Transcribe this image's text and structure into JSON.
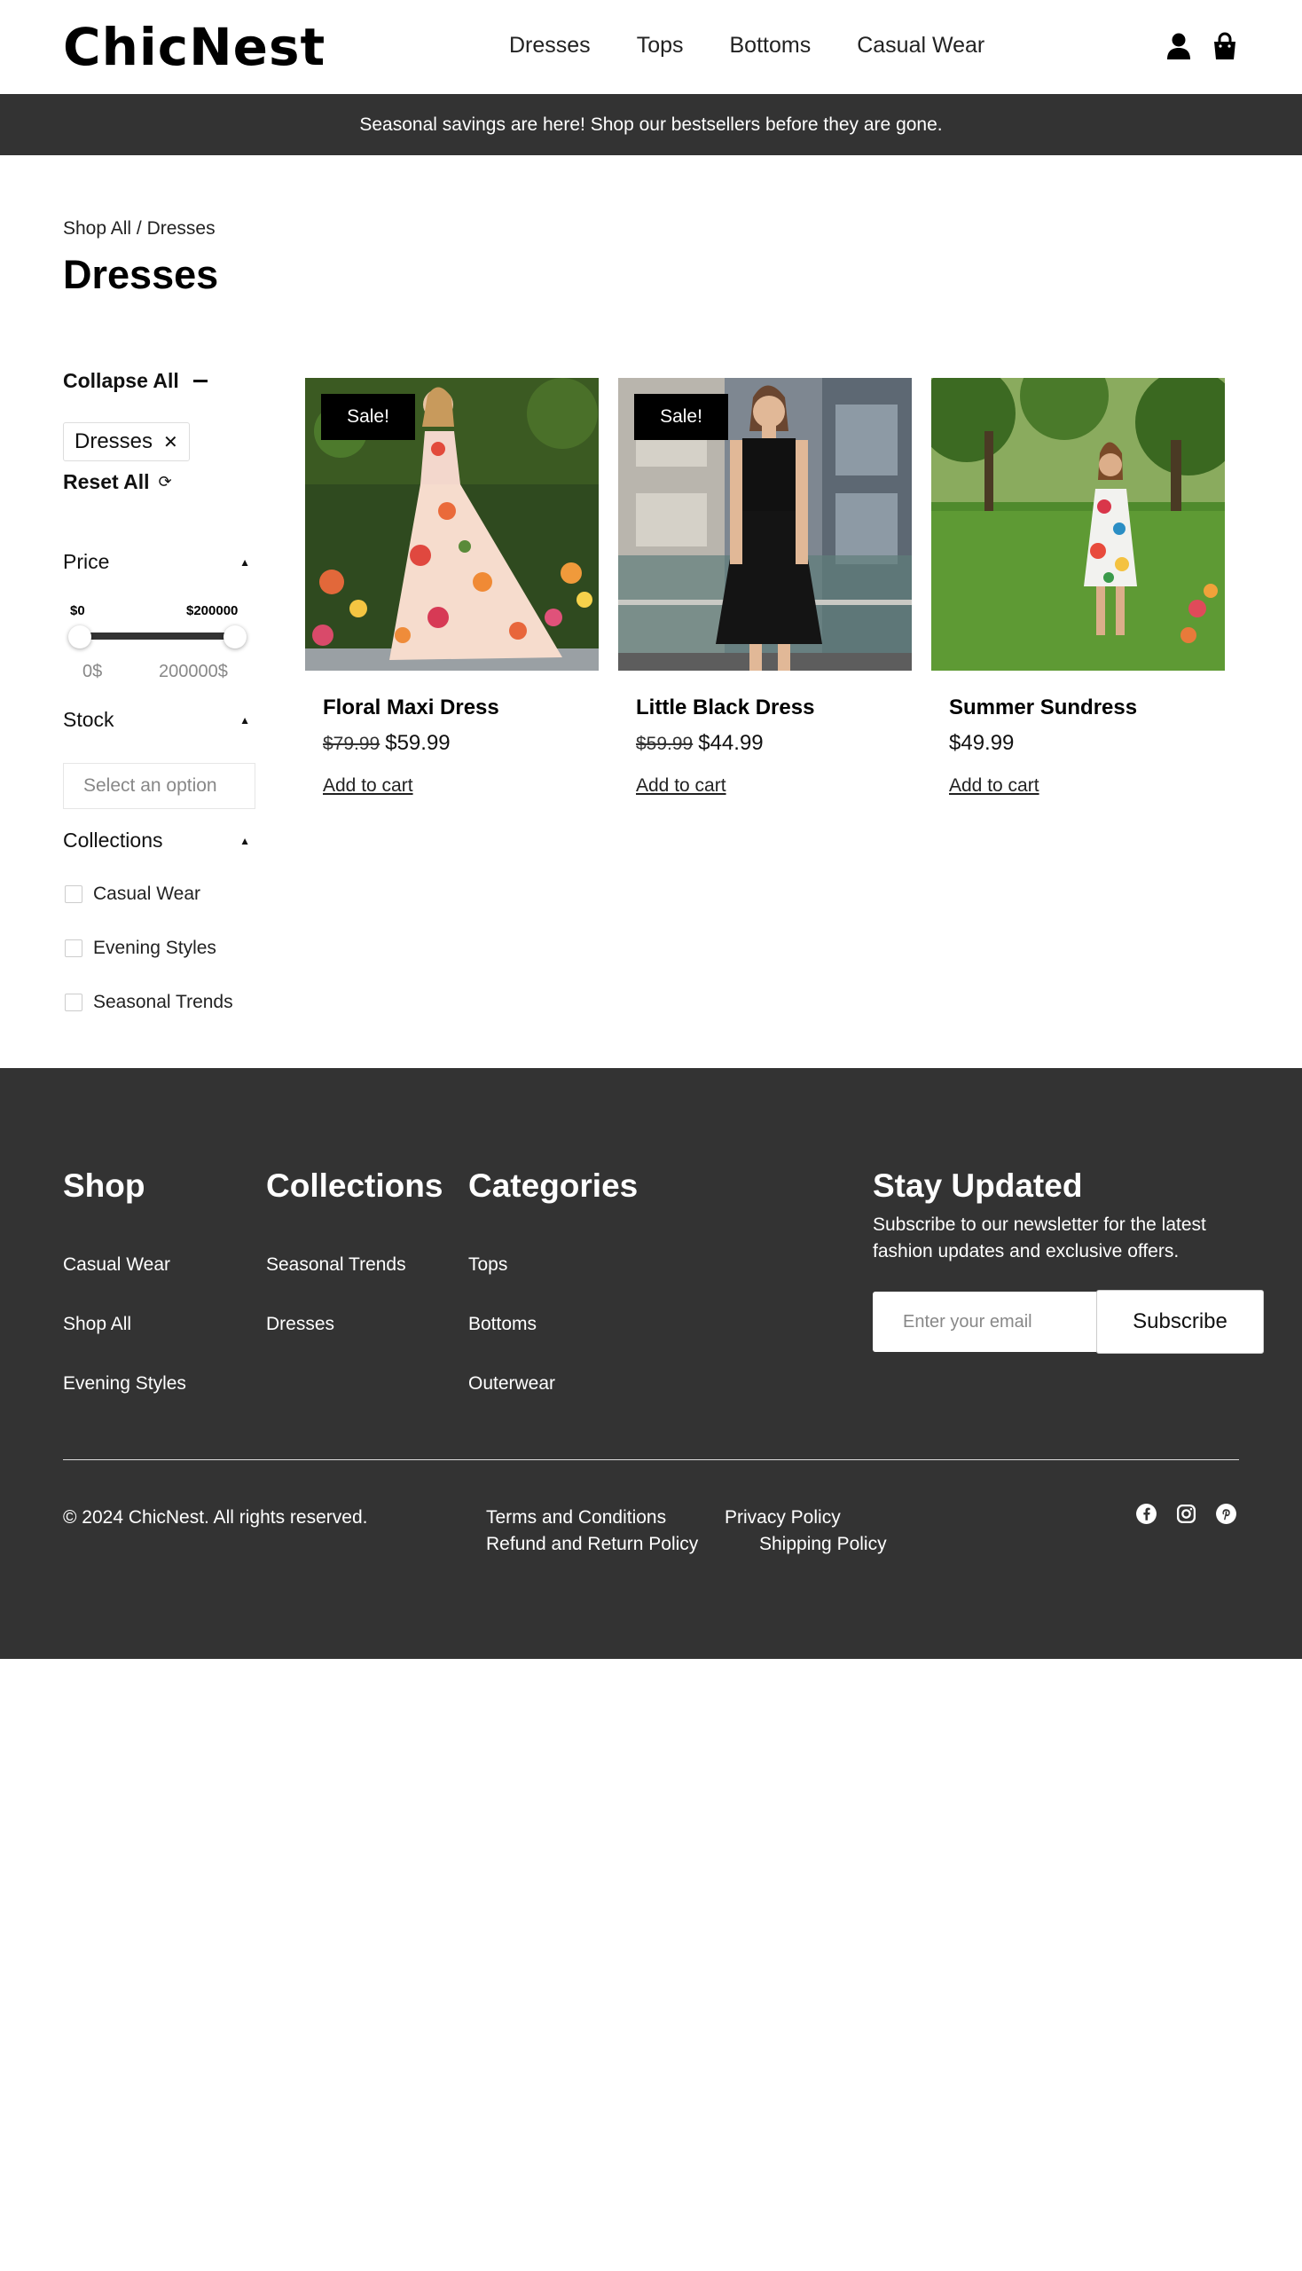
{
  "header": {
    "logo": "ChicNest",
    "nav": [
      "Dresses",
      "Tops",
      "Bottoms",
      "Casual Wear"
    ],
    "icons": [
      "user-icon",
      "shopping-bag-icon"
    ]
  },
  "announcement": "Seasonal savings are here! Shop our bestsellers before they are gone.",
  "breadcrumb": {
    "root": "Shop All",
    "separator": " / ",
    "current": "Dresses"
  },
  "page_title": "Dresses",
  "filters": {
    "collapse_all": "Collapse All",
    "active_chip": "Dresses",
    "chip_close": "✕",
    "reset_all": "Reset All",
    "price": {
      "label": "Price",
      "min_label": "$0",
      "max_label": "$200000",
      "min_input": "0$",
      "max_input": "200000$"
    },
    "stock": {
      "label": "Stock",
      "placeholder": "Select an option"
    },
    "collections": {
      "label": "Collections",
      "items": [
        "Casual Wear",
        "Evening Styles",
        "Seasonal Trends"
      ]
    }
  },
  "products": [
    {
      "name": "Floral Maxi Dress",
      "old_price": "$79.99",
      "price": "$59.99",
      "badge": "Sale!",
      "action": "Add to cart"
    },
    {
      "name": "Little Black Dress",
      "old_price": "$59.99",
      "price": "$44.99",
      "badge": "Sale!",
      "action": "Add to cart"
    },
    {
      "name": "Summer Sundress",
      "old_price": "",
      "price": "$49.99",
      "badge": "",
      "action": "Add to cart"
    }
  ],
  "footer": {
    "shop": {
      "title": "Shop",
      "links": [
        "Casual Wear",
        "Shop All",
        "Evening Styles"
      ]
    },
    "collections": {
      "title": "Collections",
      "links": [
        "Seasonal Trends",
        "Dresses"
      ]
    },
    "categories": {
      "title": "Categories",
      "links": [
        "Tops",
        "Bottoms",
        "Outerwear"
      ]
    },
    "newsletter": {
      "title": "Stay Updated",
      "text": "Subscribe to our newsletter for the latest fashion updates and exclusive offers.",
      "placeholder": "Enter your email",
      "button": "Subscribe"
    },
    "copyright": "© 2024 ChicNest. All rights reserved.",
    "legal": [
      "Terms and Conditions",
      "Privacy Policy",
      "Refund and Return Policy",
      "Shipping Policy"
    ],
    "socials": [
      "facebook-icon",
      "instagram-icon",
      "pinterest-icon"
    ]
  },
  "colors": {
    "dark_bg": "#333333",
    "sale_badge": "#000000",
    "text": "#111111"
  }
}
